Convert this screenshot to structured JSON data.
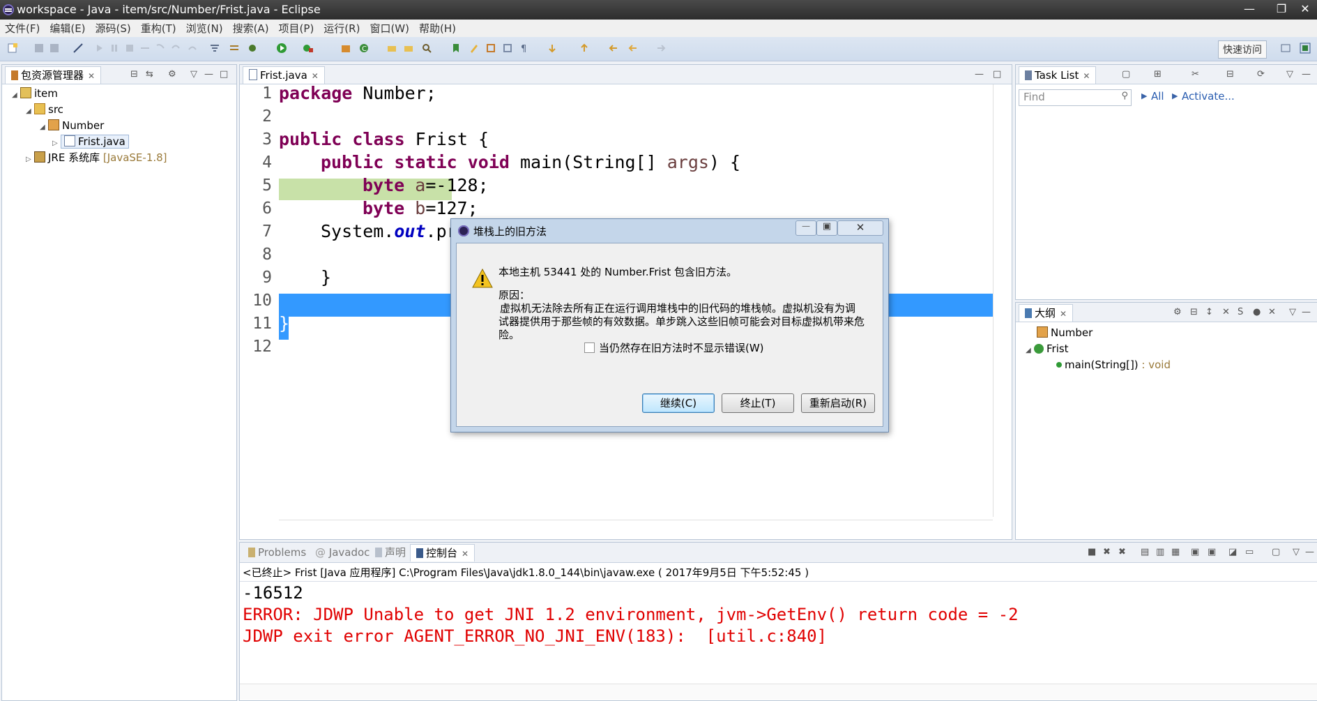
{
  "window": {
    "title": "workspace - Java - item/src/Number/Frist.java - Eclipse",
    "min": "—",
    "max": "❐",
    "close": "✕"
  },
  "menu": [
    "文件(F)",
    "编辑(E)",
    "源码(S)",
    "重构(T)",
    "浏览(N)",
    "搜索(A)",
    "项目(P)",
    "运行(R)",
    "窗口(W)",
    "帮助(H)"
  ],
  "toolbar": {
    "quick_access": "快速访问"
  },
  "package_explorer": {
    "title": "包资源管理器",
    "tree": [
      {
        "label": "item",
        "level": 0,
        "icon": "project-icon"
      },
      {
        "label": "src",
        "level": 1,
        "icon": "source-folder-icon"
      },
      {
        "label": "Number",
        "level": 2,
        "icon": "package-icon"
      },
      {
        "label": "Frist.java",
        "level": 3,
        "icon": "java-file-icon"
      },
      {
        "label": "JRE 系统库",
        "suffix": "[JavaSE-1.8]",
        "level": 1,
        "icon": "library-icon"
      }
    ]
  },
  "editor": {
    "tab": "Frist.java",
    "line_numbers": [
      "1",
      "2",
      "3",
      "4",
      "5",
      "6",
      "7",
      "8",
      "9",
      "10",
      "11",
      "12"
    ],
    "lines": {
      "l1_kw": "package",
      "l1_rest": " Number;",
      "l3_kw": "public class",
      "l3_rest": " Frist {",
      "l4_kw": "public static void",
      "l4_rest": " main(String[] ",
      "l4_var": "args",
      "l4_end": ") {",
      "l5_kw": "byte",
      "l5_var": "a",
      "l5_rest": "=-128;",
      "l6_kw": "byte",
      "l6_var": "b",
      "l6_rest": "=127;",
      "l7_a": "System.",
      "l7_fld": "out",
      "l7_b": ".pr",
      "l9": "}",
      "l11": "}"
    }
  },
  "task_list": {
    "title": "Task List",
    "find_placeholder": "Find",
    "all": "All",
    "activate": "Activate..."
  },
  "outline": {
    "title": "大纲",
    "items": [
      {
        "label": "Number"
      },
      {
        "label": "Frist"
      },
      {
        "label": "main(String[])",
        "suffix": " : void"
      }
    ]
  },
  "dialog": {
    "title": "堆栈上的旧方法",
    "message": "本地主机 53441 处的 Number.Frist 包含旧方法。",
    "reason_label": "原因：",
    "reason_lines": [
      "虚拟机无法除去所有正在运行调用堆栈中的旧代码的堆栈帧。虚拟机没有为调",
      "试器提供用于那些帧的有效数据。单步跳入这些旧帧可能会对目标虚拟机带来危",
      "险。"
    ],
    "checkbox": "当仍然存在旧方法时不显示错误(W)",
    "buttons": {
      "continue": "继续(C)",
      "terminate": "终止(T)",
      "restart": "重新启动(R)"
    }
  },
  "console": {
    "tabs": [
      "Problems",
      "Javadoc",
      "声明",
      "控制台"
    ],
    "header": "<已终止> Frist [Java 应用程序] C:\\Program Files\\Java\\jdk1.8.0_144\\bin\\javaw.exe ( 2017年9月5日 下午5:52:45 )",
    "output": "-16512",
    "errors": [
      "ERROR: JDWP Unable to get JNI 1.2 environment, jvm->GetEnv() return code = -2",
      "JDWP exit error AGENT_ERROR_NO_JNI_ENV(183):  [util.c:840]"
    ]
  },
  "colors": {
    "keyword": "#7f0055",
    "error": "#e00000",
    "selection": "#3399ff",
    "highlight": "#c8e1a8"
  }
}
